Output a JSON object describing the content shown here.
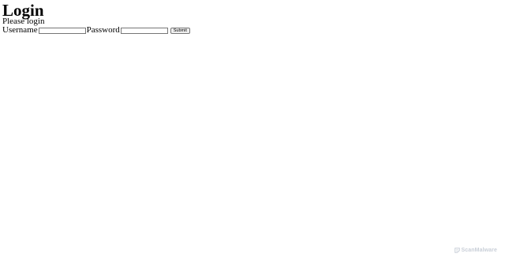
{
  "page": {
    "title": "Login",
    "subtitle": "Please login"
  },
  "form": {
    "username_label": "Username",
    "username_value": "",
    "password_label": "Password",
    "password_value": "",
    "submit_label": "Submit"
  },
  "watermark": {
    "text": "ScanMalware",
    "icon": "scanmalware-logo-icon",
    "color": "#c9cfd8"
  }
}
